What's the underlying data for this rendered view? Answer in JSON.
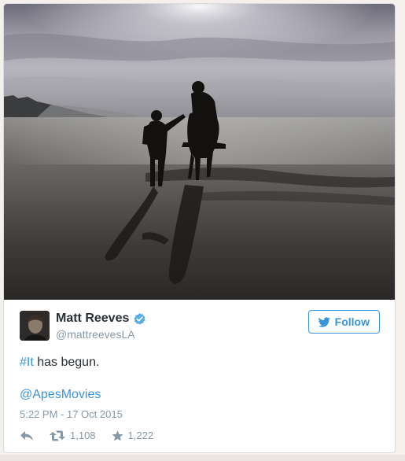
{
  "tweet": {
    "author": {
      "display_name": "Matt Reeves",
      "handle": "@mattreevesLA",
      "verified": true
    },
    "follow_label": "Follow",
    "text": {
      "hashtag": "#It",
      "rest": " has begun."
    },
    "mention": "@ApesMovies",
    "timestamp": "5:22 PM - 17 Oct 2015",
    "stats": {
      "retweets": "1,108",
      "favorites": "1,222"
    },
    "icons": {
      "verified": "verified-badge-icon",
      "follow": "twitter-bird-icon",
      "reply": "reply-icon",
      "retweet": "retweet-icon",
      "favorite": "star-icon"
    },
    "colors": {
      "link_blue": "#3b94d9",
      "text_dark": "#292f33",
      "text_muted": "#8899a6"
    }
  }
}
